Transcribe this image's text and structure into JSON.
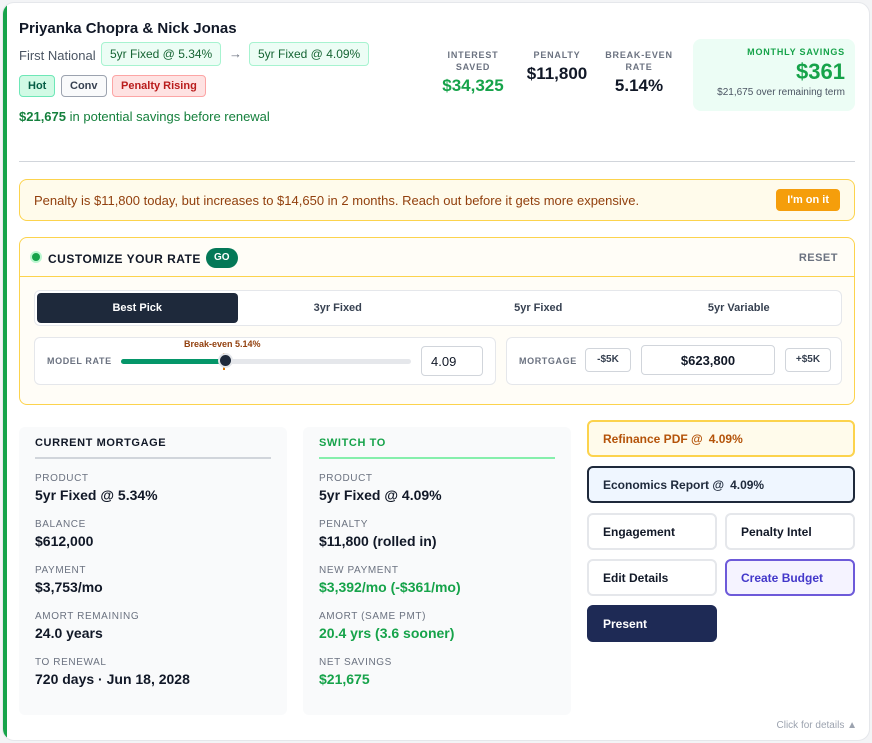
{
  "client": {
    "name": "Priyanka Chopra & Nick Jonas",
    "lender": "First National",
    "current_rate_chip": "5yr Fixed @ 5.34%",
    "arrow": "→",
    "new_rate_chip": "5yr Fixed @ 4.09%",
    "tags": [
      "Hot",
      "Conv",
      "Penalty Rising"
    ],
    "savings_amount": "$21,675",
    "savings_text": "in potential savings before renewal"
  },
  "stats": {
    "interest_saved_label": "INTEREST SAVED",
    "interest_saved": "$34,325",
    "penalty_label": "PENALTY",
    "penalty": "$11,800",
    "break_even_label": "BREAK-EVEN RATE",
    "break_even": "5.14%",
    "monthly_label": "MONTHLY SAVINGS",
    "monthly": "$361",
    "monthly_sub": "$21,675 over remaining term"
  },
  "alert": {
    "text": "Penalty is $11,800 today, but increases to $14,650 in 2 months. Reach out before it gets more expensive.",
    "button": "I'm on it"
  },
  "customize": {
    "title": "CUSTOMIZE YOUR RATE",
    "badge": "GO",
    "reset": "RESET",
    "tabs": [
      "Best Pick",
      "3yr Fixed",
      "5yr Fixed",
      "5yr Variable"
    ],
    "active_tab": "Best Pick",
    "model_rate_label": "MODEL RATE",
    "break_even_marker": "Break-even 5.14%",
    "slider_fill_fraction": 0.36,
    "break_even_fraction": 0.355,
    "rate_value": "4.09",
    "mortgage_label": "MORTGAGE",
    "minus_label": "-$5K",
    "mortgage_value": "$623,800",
    "plus_label": "+$5K"
  },
  "current": {
    "title": "CURRENT MORTGAGE",
    "rows": [
      {
        "k": "PRODUCT",
        "v": "5yr Fixed @ 5.34%"
      },
      {
        "k": "BALANCE",
        "v": "$612,000"
      },
      {
        "k": "PAYMENT",
        "v": "$3,753/mo"
      },
      {
        "k": "AMORT REMAINING",
        "v": "24.0 years"
      },
      {
        "k": "TO RENEWAL",
        "v": "720 days · Jun 18, 2028"
      }
    ]
  },
  "switch": {
    "title": "SWITCH TO",
    "rows": [
      {
        "k": "PRODUCT",
        "v": "5yr Fixed @ 4.09%"
      },
      {
        "k": "PENALTY",
        "v": "$11,800 (rolled in)"
      },
      {
        "k": "NEW PAYMENT",
        "v": "$3,392/mo (-$361/mo)"
      },
      {
        "k": "AMORT (SAME PMT)",
        "v": "20.4 yrs (3.6 sooner)"
      },
      {
        "k": "NET SAVINGS",
        "v": "$21,675"
      }
    ]
  },
  "actions": {
    "refinance": "Refinance PDF @",
    "refinance_rate": "4.09%",
    "economics": "Economics Report @",
    "economics_rate": "4.09%",
    "engagement": "Engagement",
    "penalty_intel": "Penalty Intel",
    "edit_details": "Edit Details",
    "create_budget": "Create Budget",
    "present": "Present"
  },
  "footer": {
    "details": "Click for details ▲"
  },
  "colors": {
    "accent_green": "#16a34a",
    "navy": "#1e293b",
    "amber": "#f59e0b"
  }
}
